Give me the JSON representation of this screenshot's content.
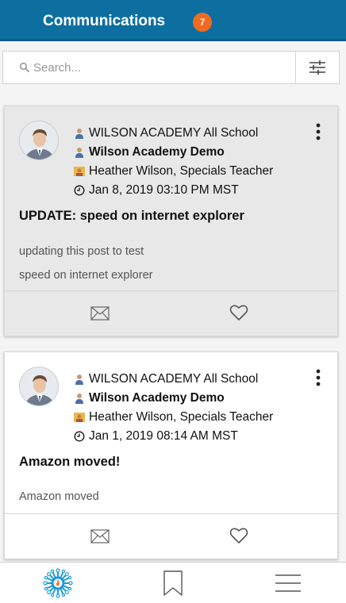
{
  "header": {
    "title": "Communications",
    "badge_count": "7"
  },
  "search": {
    "placeholder": "Search...",
    "value": ""
  },
  "posts": [
    {
      "group": "WILSON ACADEMY All School",
      "channel": "Wilson Academy Demo",
      "author": "Heather Wilson, Specials Teacher",
      "date": "Jan 8, 2019 03:10 PM MST",
      "title": "UPDATE: speed on internet explorer",
      "body_lines": [
        "updating this post to test",
        "speed on internet explorer"
      ]
    },
    {
      "group": "WILSON ACADEMY All School",
      "channel": "Wilson Academy Demo",
      "author": "Heather Wilson, Specials Teacher",
      "date": "Jan 1, 2019 08:14 AM MST",
      "title": "Amazon moved!",
      "body_lines": [
        "Amazon moved"
      ]
    }
  ],
  "colors": {
    "header_bg": "#0d6fa0",
    "badge": "#f26a21",
    "active_tab": "#1a9bd7"
  },
  "icons": {
    "tab_home": "virus-logo-icon",
    "tab_bookmark": "bookmark-icon",
    "tab_menu": "hamburger-menu-icon"
  }
}
